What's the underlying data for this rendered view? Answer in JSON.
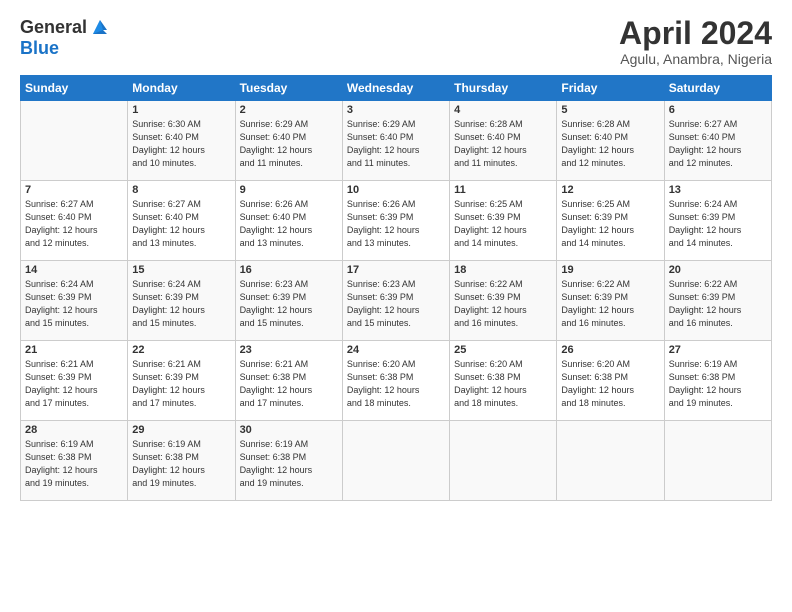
{
  "header": {
    "logo_general": "General",
    "logo_blue": "Blue",
    "main_title": "April 2024",
    "subtitle": "Agulu, Anambra, Nigeria"
  },
  "calendar": {
    "days_of_week": [
      "Sunday",
      "Monday",
      "Tuesday",
      "Wednesday",
      "Thursday",
      "Friday",
      "Saturday"
    ],
    "weeks": [
      [
        {
          "num": "",
          "info": ""
        },
        {
          "num": "1",
          "info": "Sunrise: 6:30 AM\nSunset: 6:40 PM\nDaylight: 12 hours\nand 10 minutes."
        },
        {
          "num": "2",
          "info": "Sunrise: 6:29 AM\nSunset: 6:40 PM\nDaylight: 12 hours\nand 11 minutes."
        },
        {
          "num": "3",
          "info": "Sunrise: 6:29 AM\nSunset: 6:40 PM\nDaylight: 12 hours\nand 11 minutes."
        },
        {
          "num": "4",
          "info": "Sunrise: 6:28 AM\nSunset: 6:40 PM\nDaylight: 12 hours\nand 11 minutes."
        },
        {
          "num": "5",
          "info": "Sunrise: 6:28 AM\nSunset: 6:40 PM\nDaylight: 12 hours\nand 12 minutes."
        },
        {
          "num": "6",
          "info": "Sunrise: 6:27 AM\nSunset: 6:40 PM\nDaylight: 12 hours\nand 12 minutes."
        }
      ],
      [
        {
          "num": "7",
          "info": "Sunrise: 6:27 AM\nSunset: 6:40 PM\nDaylight: 12 hours\nand 12 minutes."
        },
        {
          "num": "8",
          "info": "Sunrise: 6:27 AM\nSunset: 6:40 PM\nDaylight: 12 hours\nand 13 minutes."
        },
        {
          "num": "9",
          "info": "Sunrise: 6:26 AM\nSunset: 6:40 PM\nDaylight: 12 hours\nand 13 minutes."
        },
        {
          "num": "10",
          "info": "Sunrise: 6:26 AM\nSunset: 6:39 PM\nDaylight: 12 hours\nand 13 minutes."
        },
        {
          "num": "11",
          "info": "Sunrise: 6:25 AM\nSunset: 6:39 PM\nDaylight: 12 hours\nand 14 minutes."
        },
        {
          "num": "12",
          "info": "Sunrise: 6:25 AM\nSunset: 6:39 PM\nDaylight: 12 hours\nand 14 minutes."
        },
        {
          "num": "13",
          "info": "Sunrise: 6:24 AM\nSunset: 6:39 PM\nDaylight: 12 hours\nand 14 minutes."
        }
      ],
      [
        {
          "num": "14",
          "info": "Sunrise: 6:24 AM\nSunset: 6:39 PM\nDaylight: 12 hours\nand 15 minutes."
        },
        {
          "num": "15",
          "info": "Sunrise: 6:24 AM\nSunset: 6:39 PM\nDaylight: 12 hours\nand 15 minutes."
        },
        {
          "num": "16",
          "info": "Sunrise: 6:23 AM\nSunset: 6:39 PM\nDaylight: 12 hours\nand 15 minutes."
        },
        {
          "num": "17",
          "info": "Sunrise: 6:23 AM\nSunset: 6:39 PM\nDaylight: 12 hours\nand 15 minutes."
        },
        {
          "num": "18",
          "info": "Sunrise: 6:22 AM\nSunset: 6:39 PM\nDaylight: 12 hours\nand 16 minutes."
        },
        {
          "num": "19",
          "info": "Sunrise: 6:22 AM\nSunset: 6:39 PM\nDaylight: 12 hours\nand 16 minutes."
        },
        {
          "num": "20",
          "info": "Sunrise: 6:22 AM\nSunset: 6:39 PM\nDaylight: 12 hours\nand 16 minutes."
        }
      ],
      [
        {
          "num": "21",
          "info": "Sunrise: 6:21 AM\nSunset: 6:39 PM\nDaylight: 12 hours\nand 17 minutes."
        },
        {
          "num": "22",
          "info": "Sunrise: 6:21 AM\nSunset: 6:39 PM\nDaylight: 12 hours\nand 17 minutes."
        },
        {
          "num": "23",
          "info": "Sunrise: 6:21 AM\nSunset: 6:38 PM\nDaylight: 12 hours\nand 17 minutes."
        },
        {
          "num": "24",
          "info": "Sunrise: 6:20 AM\nSunset: 6:38 PM\nDaylight: 12 hours\nand 18 minutes."
        },
        {
          "num": "25",
          "info": "Sunrise: 6:20 AM\nSunset: 6:38 PM\nDaylight: 12 hours\nand 18 minutes."
        },
        {
          "num": "26",
          "info": "Sunrise: 6:20 AM\nSunset: 6:38 PM\nDaylight: 12 hours\nand 18 minutes."
        },
        {
          "num": "27",
          "info": "Sunrise: 6:19 AM\nSunset: 6:38 PM\nDaylight: 12 hours\nand 19 minutes."
        }
      ],
      [
        {
          "num": "28",
          "info": "Sunrise: 6:19 AM\nSunset: 6:38 PM\nDaylight: 12 hours\nand 19 minutes."
        },
        {
          "num": "29",
          "info": "Sunrise: 6:19 AM\nSunset: 6:38 PM\nDaylight: 12 hours\nand 19 minutes."
        },
        {
          "num": "30",
          "info": "Sunrise: 6:19 AM\nSunset: 6:38 PM\nDaylight: 12 hours\nand 19 minutes."
        },
        {
          "num": "",
          "info": ""
        },
        {
          "num": "",
          "info": ""
        },
        {
          "num": "",
          "info": ""
        },
        {
          "num": "",
          "info": ""
        }
      ]
    ]
  }
}
